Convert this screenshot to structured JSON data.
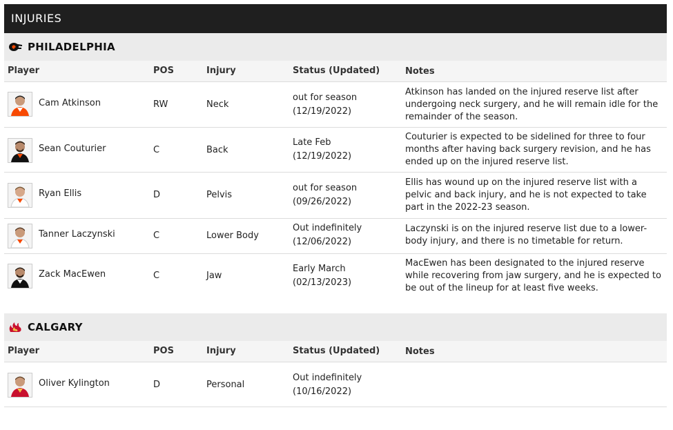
{
  "page": {
    "title": "INJURIES"
  },
  "columns": {
    "player": "Player",
    "pos": "POS",
    "injury": "Injury",
    "status": "Status (Updated)",
    "notes": "Notes"
  },
  "teams": [
    {
      "name": "PHILADELPHIA",
      "logo_icon": "flyers-logo-icon",
      "accent": "#f74902",
      "players": [
        {
          "name": "Cam Atkinson",
          "pos": "RW",
          "injury": "Neck",
          "status": "out for season",
          "updated": "(12/19/2022)",
          "notes": "Atkinson has landed on the injured reserve list after undergoing neck surgery, and he will remain idle for the remainder of the season."
        },
        {
          "name": "Sean Couturier",
          "pos": "C",
          "injury": "Back",
          "status": "Late Feb",
          "updated": "(12/19/2022)",
          "notes": "Couturier is expected to be sidelined for three to four months after having back surgery revision, and he has ended up on the injured reserve list."
        },
        {
          "name": "Ryan Ellis",
          "pos": "D",
          "injury": "Pelvis",
          "status": "out for season",
          "updated": "(09/26/2022)",
          "notes": "Ellis has wound up on the injured reserve list with a pelvic and back injury, and he is not expected to take part in the 2022-23 season."
        },
        {
          "name": "Tanner Laczynski",
          "pos": "C",
          "injury": "Lower Body",
          "status": "Out indefinitely",
          "updated": "(12/06/2022)",
          "notes": "Laczynski is on the injured reserve list due to a lower-body injury, and there is no timetable for return."
        },
        {
          "name": "Zack MacEwen",
          "pos": "C",
          "injury": "Jaw",
          "status": "Early March",
          "updated": "(02/13/2023)",
          "notes": "MacEwen has been designated to the injured reserve while recovering from jaw surgery, and he is expected to be out of the lineup for at least five weeks."
        }
      ]
    },
    {
      "name": "CALGARY",
      "logo_icon": "flames-logo-icon",
      "accent": "#c8102e",
      "players": [
        {
          "name": "Oliver Kylington",
          "pos": "D",
          "injury": "Personal",
          "status": "Out indefinitely",
          "updated": "(10/16/2022)",
          "notes": ""
        }
      ]
    }
  ]
}
